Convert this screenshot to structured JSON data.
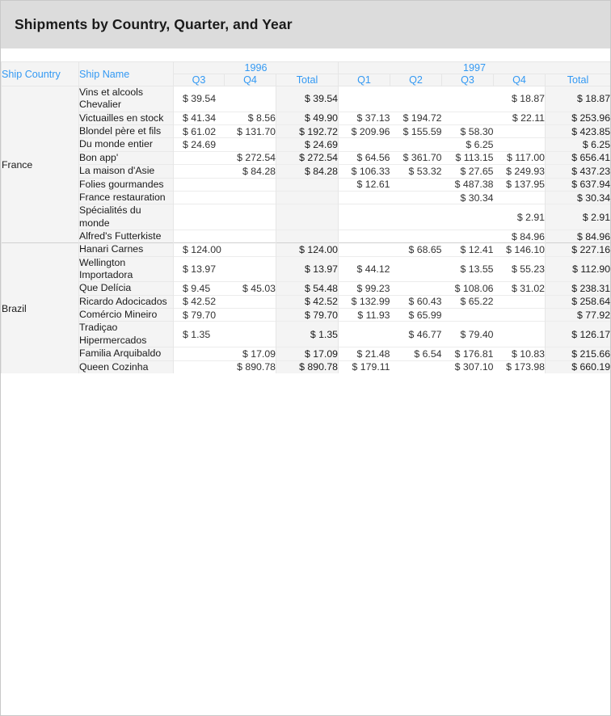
{
  "title": "Shipments by Country, Quarter, and Year",
  "colors": {
    "header_text": "#3399f3",
    "title_bar_bg": "#dcdcdc",
    "header_bg": "#f4f4f4",
    "total_bg": "#f4f4f4",
    "grid": "#e6e6e6"
  },
  "header": {
    "row_label_1": "Ship Country",
    "row_label_2": "Ship Name",
    "years": [
      {
        "label": "1996",
        "quarters": [
          "Q3",
          "Q4"
        ],
        "total": "Total"
      },
      {
        "label": "1997",
        "quarters": [
          "Q1",
          "Q2",
          "Q3",
          "Q4"
        ],
        "total": "Total"
      }
    ]
  },
  "chart_data": {
    "type": "table",
    "title": "Shipments by Country, Quarter, and Year",
    "columns": [
      "Ship Country",
      "Ship Name",
      "1996 Q3",
      "1996 Q4",
      "1996 Total",
      "1997 Q1",
      "1997 Q2",
      "1997 Q3",
      "1997 Q4",
      "1997 Total"
    ],
    "groups": [
      {
        "country": "France",
        "rows": [
          {
            "name": "Vins et alcools Chevalier",
            "q3_96": "$ 39.54",
            "q4_96": "",
            "total_96": "$ 39.54",
            "q1_97": "",
            "q2_97": "",
            "q3_97": "",
            "q4_97": "$ 18.87",
            "total_97": "$ 18.87"
          },
          {
            "name": "Victuailles en stock",
            "q3_96": "$ 41.34",
            "q4_96": "$ 8.56",
            "total_96": "$ 49.90",
            "q1_97": "$ 37.13",
            "q2_97": "$ 194.72",
            "q3_97": "",
            "q4_97": "$ 22.11",
            "total_97": "$ 253.96"
          },
          {
            "name": "Blondel père et fils",
            "q3_96": "$ 61.02",
            "q4_96": "$ 131.70",
            "total_96": "$ 192.72",
            "q1_97": "$ 209.96",
            "q2_97": "$ 155.59",
            "q3_97": "$ 58.30",
            "q4_97": "",
            "total_97": "$ 423.85"
          },
          {
            "name": "Du monde entier",
            "q3_96": "$ 24.69",
            "q4_96": "",
            "total_96": "$ 24.69",
            "q1_97": "",
            "q2_97": "",
            "q3_97": "$ 6.25",
            "q4_97": "",
            "total_97": "$ 6.25"
          },
          {
            "name": "Bon app'",
            "q3_96": "",
            "q4_96": "$ 272.54",
            "total_96": "$ 272.54",
            "q1_97": "$ 64.56",
            "q2_97": "$ 361.70",
            "q3_97": "$ 113.15",
            "q4_97": "$ 117.00",
            "total_97": "$ 656.41"
          },
          {
            "name": "La maison d'Asie",
            "q3_96": "",
            "q4_96": "$ 84.28",
            "total_96": "$ 84.28",
            "q1_97": "$ 106.33",
            "q2_97": "$ 53.32",
            "q3_97": "$ 27.65",
            "q4_97": "$ 249.93",
            "total_97": "$ 437.23"
          },
          {
            "name": "Folies gourmandes",
            "q3_96": "",
            "q4_96": "",
            "total_96": "",
            "q1_97": "$ 12.61",
            "q2_97": "",
            "q3_97": "$ 487.38",
            "q4_97": "$ 137.95",
            "total_97": "$ 637.94"
          },
          {
            "name": "France restauration",
            "q3_96": "",
            "q4_96": "",
            "total_96": "",
            "q1_97": "",
            "q2_97": "",
            "q3_97": "$ 30.34",
            "q4_97": "",
            "total_97": "$ 30.34"
          },
          {
            "name": "Spécialités du monde",
            "q3_96": "",
            "q4_96": "",
            "total_96": "",
            "q1_97": "",
            "q2_97": "",
            "q3_97": "",
            "q4_97": "$ 2.91",
            "total_97": "$ 2.91"
          },
          {
            "name": "Alfred's Futterkiste",
            "q3_96": "",
            "q4_96": "",
            "total_96": "",
            "q1_97": "",
            "q2_97": "",
            "q3_97": "",
            "q4_97": "$ 84.96",
            "total_97": "$ 84.96"
          }
        ]
      },
      {
        "country": "Brazil",
        "rows": [
          {
            "name": "Hanari Carnes",
            "q3_96": "$ 124.00",
            "q4_96": "",
            "total_96": "$ 124.00",
            "q1_97": "",
            "q2_97": "$ 68.65",
            "q3_97": "$ 12.41",
            "q4_97": "$ 146.10",
            "total_97": "$ 227.16"
          },
          {
            "name": "Wellington Importadora",
            "q3_96": "$ 13.97",
            "q4_96": "",
            "total_96": "$ 13.97",
            "q1_97": "$ 44.12",
            "q2_97": "",
            "q3_97": "$ 13.55",
            "q4_97": "$ 55.23",
            "total_97": "$ 112.90"
          },
          {
            "name": "Que Delícia",
            "q3_96": "$ 9.45",
            "q4_96": "$ 45.03",
            "total_96": "$ 54.48",
            "q1_97": "$ 99.23",
            "q2_97": "",
            "q3_97": "$ 108.06",
            "q4_97": "$ 31.02",
            "total_97": "$ 238.31"
          },
          {
            "name": "Ricardo Adocicados",
            "q3_96": "$ 42.52",
            "q4_96": "",
            "total_96": "$ 42.52",
            "q1_97": "$ 132.99",
            "q2_97": "$ 60.43",
            "q3_97": "$ 65.22",
            "q4_97": "",
            "total_97": "$ 258.64"
          },
          {
            "name": "Comércio Mineiro",
            "q3_96": "$ 79.70",
            "q4_96": "",
            "total_96": "$ 79.70",
            "q1_97": "$ 11.93",
            "q2_97": "$ 65.99",
            "q3_97": "",
            "q4_97": "",
            "total_97": "$ 77.92"
          },
          {
            "name": "Tradiçao Hipermercados",
            "q3_96": "$ 1.35",
            "q4_96": "",
            "total_96": "$ 1.35",
            "q1_97": "",
            "q2_97": "$ 46.77",
            "q3_97": "$ 79.40",
            "q4_97": "",
            "total_97": "$ 126.17"
          },
          {
            "name": "Familia Arquibaldo",
            "q3_96": "",
            "q4_96": "$ 17.09",
            "total_96": "$ 17.09",
            "q1_97": "$ 21.48",
            "q2_97": "$ 6.54",
            "q3_97": "$ 176.81",
            "q4_97": "$ 10.83",
            "total_97": "$ 215.66"
          },
          {
            "name": "Queen Cozinha",
            "q3_96": "",
            "q4_96": "$ 890.78",
            "total_96": "$ 890.78",
            "q1_97": "$ 179.11",
            "q2_97": "",
            "q3_97": "$ 307.10",
            "q4_97": "$ 173.98",
            "total_97": "$ 660.19"
          }
        ]
      }
    ]
  }
}
